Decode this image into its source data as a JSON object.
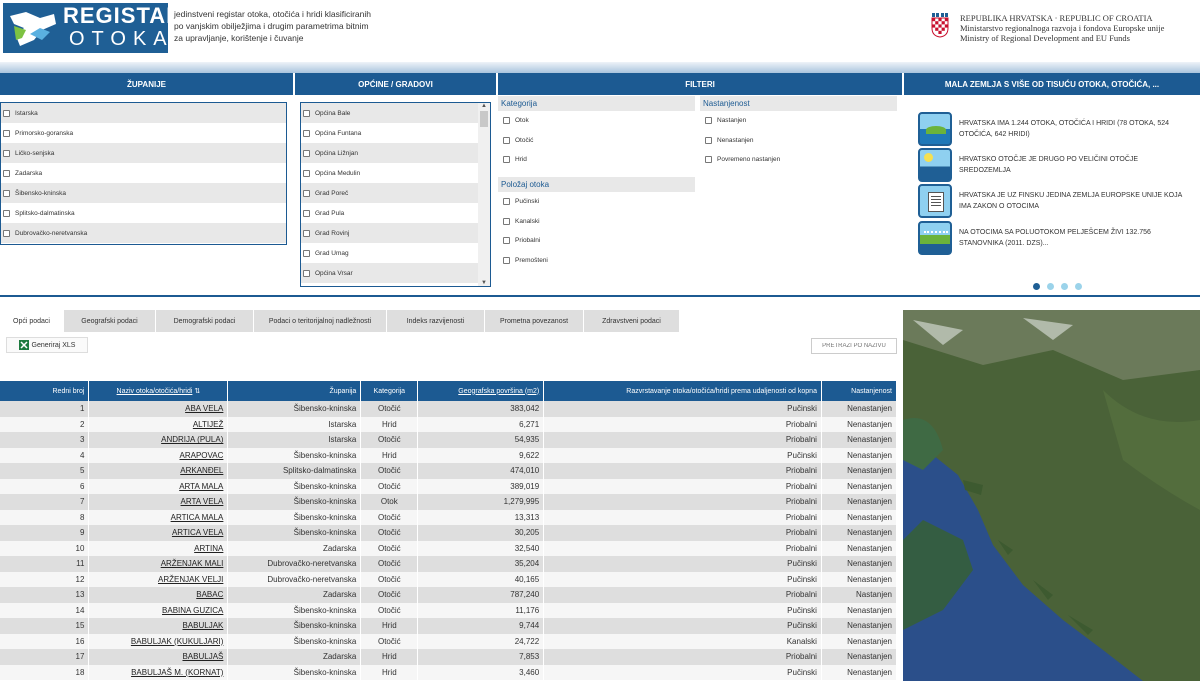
{
  "header": {
    "logo_title": "REGISTAR",
    "logo_subtitle": "OTOKA",
    "tagline": [
      "jedinstveni registar otoka, otočića i hridi klasificiranih",
      "po vanjskim obilježjima i drugim parametrima bitnim",
      "za upravljanje, korištenje i čuvanje"
    ],
    "gov_lines": [
      "REPUBLIKA HRVATSKA · REPUBLIC OF CROATIA",
      "Ministarstvo regionalnoga razvoja i fondova Europske unije",
      "Ministry of Regional Development and EU Funds"
    ]
  },
  "columns": {
    "zupanije": "ŽUPANIJE",
    "opcine": "OPĆINE / GRADOVI",
    "filteri": "FILTERI",
    "news": "MALA ZEMLJA S VIŠE OD TISUĆU OTOKA, OTOČIĆA, ..."
  },
  "zupanije": [
    "Istarska",
    "Primorsko-goranska",
    "Ličko-senjska",
    "Zadarska",
    "Šibensko-kninska",
    "Splitsko-dalmatinska",
    "Dubrovačko-neretvanska"
  ],
  "opcine": [
    "Općina Bale",
    "Općina Funtana",
    "Općina Ližnjan",
    "Općina Medulin",
    "Grad Poreč",
    "Grad Pula",
    "Grad Rovinj",
    "Grad Umag",
    "Općina Vrsar"
  ],
  "filters": {
    "kategorija_title": "Kategorija",
    "kategorija": [
      "Otok",
      "Otočić",
      "Hrid"
    ],
    "polozaj_title": "Položaj otoka",
    "polozaj": [
      "Pučinski",
      "Kanalski",
      "Priobalni",
      "Premošteni"
    ],
    "nastanjenost_title": "Nastanjenost",
    "nastanjenost": [
      "Nastanjen",
      "Nenastanjen",
      "Povremeno nastanjen"
    ]
  },
  "news": [
    {
      "text": "HRVATSKA IMA 1.244 OTOKA, OTOČIĆA I HRIDI (78 OTOKA, 524 OTOČIĆA, 642 HRIDI)",
      "icon": "island-icon"
    },
    {
      "text": "HRVATSKO OTOČJE JE DRUGO PO VELIČINI OTOČJE SREDOZEMLJA",
      "icon": "sun-sea-icon"
    },
    {
      "text": "HRVATSKA JE UZ FINSKU JEDINA ZEMLJA EUROPSKE UNIJE KOJA IMA ZAKON O OTOCIMA",
      "icon": "document-icon"
    },
    {
      "text": "NA OTOCIMA SA POLUOTOKOM PELJEŠCEM ŽIVI 132.756 STANOVNIKA (2011. DZS)...",
      "icon": "people-icon"
    }
  ],
  "tabs": [
    "Opći podaci",
    "Geografski podaci",
    "Demografski podaci",
    "Podaci o teritorijalnoj nadležnosti",
    "Indeks razvijenosti",
    "Prometna povezanost",
    "Zdravstveni podaci"
  ],
  "toolbar": {
    "xls_label": "Generiraj XLS",
    "search_placeholder": "PRETRAŽI PO NAZIVU"
  },
  "table": {
    "headers": [
      "Redni broj",
      "Naziv otoka/otočića/hridi",
      "Županija",
      "Kategorija",
      "Geografska površina (m2)",
      "Razvrstavanje otoka/otočića/hridi prema udaljenosti od kopna",
      "Nastanjenost"
    ],
    "sort_icon": "⇅",
    "rows": [
      [
        "1",
        "ABA VELA",
        "Šibensko-kninska",
        "Otočić",
        "383,042",
        "Pučinski",
        "Nenastanjen"
      ],
      [
        "2",
        "ALTIJEŽ",
        "Istarska",
        "Hrid",
        "6,271",
        "Priobalni",
        "Nenastanjen"
      ],
      [
        "3",
        "ANDRIJA (PULA)",
        "Istarska",
        "Otočić",
        "54,935",
        "Priobalni",
        "Nenastanjen"
      ],
      [
        "4",
        "ARAPOVAC",
        "Šibensko-kninska",
        "Hrid",
        "9,622",
        "Pučinski",
        "Nenastanjen"
      ],
      [
        "5",
        "ARKANĐEL",
        "Splitsko-dalmatinska",
        "Otočić",
        "474,010",
        "Priobalni",
        "Nenastanjen"
      ],
      [
        "6",
        "ARTA MALA",
        "Šibensko-kninska",
        "Otočić",
        "389,019",
        "Priobalni",
        "Nenastanjen"
      ],
      [
        "7",
        "ARTA VELA",
        "Šibensko-kninska",
        "Otok",
        "1,279,995",
        "Priobalni",
        "Nenastanjen"
      ],
      [
        "8",
        "ARTICA MALA",
        "Šibensko-kninska",
        "Otočić",
        "13,313",
        "Priobalni",
        "Nenastanjen"
      ],
      [
        "9",
        "ARTICA VELA",
        "Šibensko-kninska",
        "Otočić",
        "30,205",
        "Priobalni",
        "Nenastanjen"
      ],
      [
        "10",
        "ARTINA",
        "Zadarska",
        "Otočić",
        "32,540",
        "Priobalni",
        "Nenastanjen"
      ],
      [
        "11",
        "ARŽENJAK MALI",
        "Dubrovačko-neretvanska",
        "Otočić",
        "35,204",
        "Pučinski",
        "Nenastanjen"
      ],
      [
        "12",
        "ARŽENJAK VELJI",
        "Dubrovačko-neretvanska",
        "Otočić",
        "40,165",
        "Pučinski",
        "Nenastanjen"
      ],
      [
        "13",
        "BABAC",
        "Zadarska",
        "Otočić",
        "787,240",
        "Priobalni",
        "Nastanjen"
      ],
      [
        "14",
        "BABINA GUZICA",
        "Šibensko-kninska",
        "Otočić",
        "11,176",
        "Pučinski",
        "Nenastanjen"
      ],
      [
        "15",
        "BABULJAK",
        "Šibensko-kninska",
        "Hrid",
        "9,744",
        "Pučinski",
        "Nenastanjen"
      ],
      [
        "16",
        "BABULJAK (KUKULJARI)",
        "Šibensko-kninska",
        "Otočić",
        "24,722",
        "Kanalski",
        "Nenastanjen"
      ],
      [
        "17",
        "BABULJAŠ",
        "Zadarska",
        "Hrid",
        "7,853",
        "Priobalni",
        "Nenastanjen"
      ],
      [
        "18",
        "BABULJAŠ M. (KORNAT)",
        "Šibensko-kninska",
        "Hrid",
        "3,460",
        "Pučinski",
        "Nenastanjen"
      ]
    ]
  },
  "colors": {
    "primary": "#1c5a92",
    "row_odd": "#dedede",
    "row_even": "#f6f6f6",
    "sea": "#2b4f8a",
    "land": "#4a6238"
  }
}
